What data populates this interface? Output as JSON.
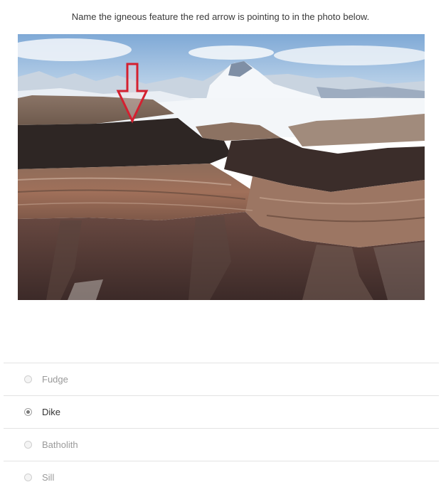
{
  "question": {
    "text": "Name the igneous feature the red arrow is pointing to in the photo below."
  },
  "photo": {
    "subject": "layered cliff with dark horizontal intrusive band below snowy mountains",
    "arrow_color": "#d42030"
  },
  "options": [
    {
      "label": "Fudge",
      "selected": false
    },
    {
      "label": "Dike",
      "selected": true
    },
    {
      "label": "Batholith",
      "selected": false
    },
    {
      "label": "Sill",
      "selected": false
    }
  ]
}
